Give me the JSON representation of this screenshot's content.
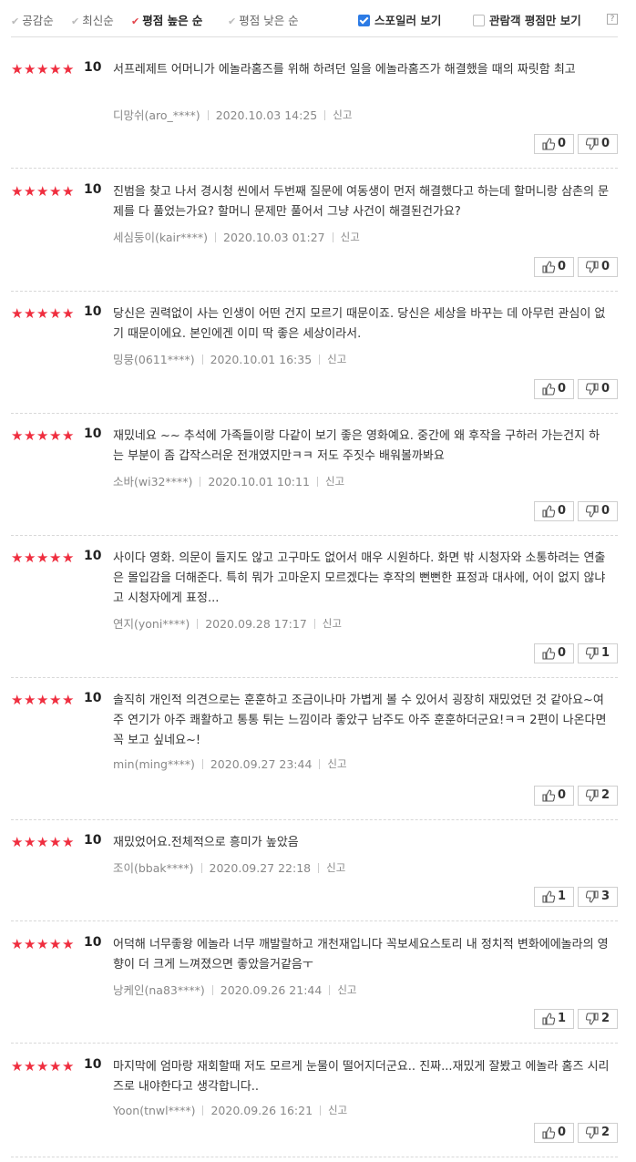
{
  "sort": {
    "options": [
      "공감순",
      "최신순",
      "평점 높은 순",
      "평점 낮은 순"
    ],
    "active_index": 2
  },
  "toggles": {
    "spoiler_label": "스포일러 보기",
    "spoiler_checked": true,
    "viewer_only_label": "관람객 평점만 보기",
    "viewer_only_checked": false,
    "help_label": "?"
  },
  "report_label": "신고",
  "colors": {
    "star": "#ef2e3f",
    "accent_check": "#2c7be5",
    "active_sort": "#e3434a"
  },
  "reviews": [
    {
      "stars": 5,
      "score": "10",
      "text": "서프레제트 어머니가 에놀라홈즈를 위해 하려던 일을 에놀라홈즈가 해결했을 때의 짜릿함 최고",
      "author": "디망쉬(aro_****)",
      "date": "2020.10.03 14:25",
      "likes": "0",
      "dislikes": "0"
    },
    {
      "stars": 5,
      "score": "10",
      "text": "진범을 찾고 나서 경시청 씬에서 두번째 질문에 여동생이 먼저 해결했다고 하는데 할머니랑 삼촌의 문제를 다 풀었는가요? 할머니 문제만 풀어서 그냥 사건이 해결된건가요?",
      "author": "세심둥이(kair****)",
      "date": "2020.10.03 01:27",
      "likes": "0",
      "dislikes": "0"
    },
    {
      "stars": 5,
      "score": "10",
      "text": "당신은 권력없이 사는 인생이 어떤 건지 모르기 때문이죠. 당신은 세상을 바꾸는 데 아무런 관심이 없기 때문이에요. 본인에겐 이미 딱 좋은 세상이라서.",
      "author": "밍뭉(0611****)",
      "date": "2020.10.01 16:35",
      "likes": "0",
      "dislikes": "0"
    },
    {
      "stars": 5,
      "score": "10",
      "text": "재밌네요 ~~ 추석에 가족들이랑 다같이 보기 좋은 영화예요. 중간에 왜 후작을 구하러 가는건지 하는 부분이 좀 갑작스러운 전개였지만ㅋㅋ 저도 주짓수 배워볼까봐요",
      "author": "소바(wi32****)",
      "date": "2020.10.01 10:11",
      "likes": "0",
      "dislikes": "0"
    },
    {
      "stars": 5,
      "score": "10",
      "text": "사이다 영화. 의문이 들지도 않고 고구마도 없어서 매우 시원하다. 화면 밖 시청자와 소통하려는 연출은 몰입감을 더해준다. 특히 뭐가 고마운지 모르겠다는 후작의 뻔뻔한 표정과 대사에, 어이 없지 않냐고 시청자에게 표정...",
      "author": "연지(yoni****)",
      "date": "2020.09.28 17:17",
      "likes": "0",
      "dislikes": "1"
    },
    {
      "stars": 5,
      "score": "10",
      "text": "솔직히 개인적 의견으로는 훈훈하고 조금이나마 가볍게 볼 수 있어서 굉장히 재밌었던 것 같아요~여주 연기가 아주 쾌활하고 통통 튀는 느낌이라 좋았구 남주도 아주 훈훈하더군요!ㅋㅋ 2편이 나온다면 꼭 보고 싶네요~!",
      "author": "min(ming****)",
      "date": "2020.09.27 23:44",
      "likes": "0",
      "dislikes": "2"
    },
    {
      "stars": 5,
      "score": "10",
      "text": "재밌었어요.전체적으로 흥미가 높았음",
      "author": "조이(bbak****)",
      "date": "2020.09.27 22:18",
      "likes": "1",
      "dislikes": "3"
    },
    {
      "stars": 5,
      "score": "10",
      "text": "어덕해 너무좋왕 에놀라 너무 깨발랄하고 개천재입니다 꼭보세요스토리 내 정치적 변화에에놀라의 영향이 더 크게 느껴졌으면 좋았을거같음ㅜ",
      "author": "낭케인(na83****)",
      "date": "2020.09.26 21:44",
      "likes": "1",
      "dislikes": "2"
    },
    {
      "stars": 5,
      "score": "10",
      "text": "마지막에 엄마랑 재회할때 저도 모르게 눈물이 떨어지더군요.. 진짜...재밌게 잘봤고 에놀라 홈즈 시리즈로 내야한다고 생각합니다..",
      "author": "Yoon(tnwl****)",
      "date": "2020.09.26 16:21",
      "likes": "0",
      "dislikes": "2"
    }
  ]
}
